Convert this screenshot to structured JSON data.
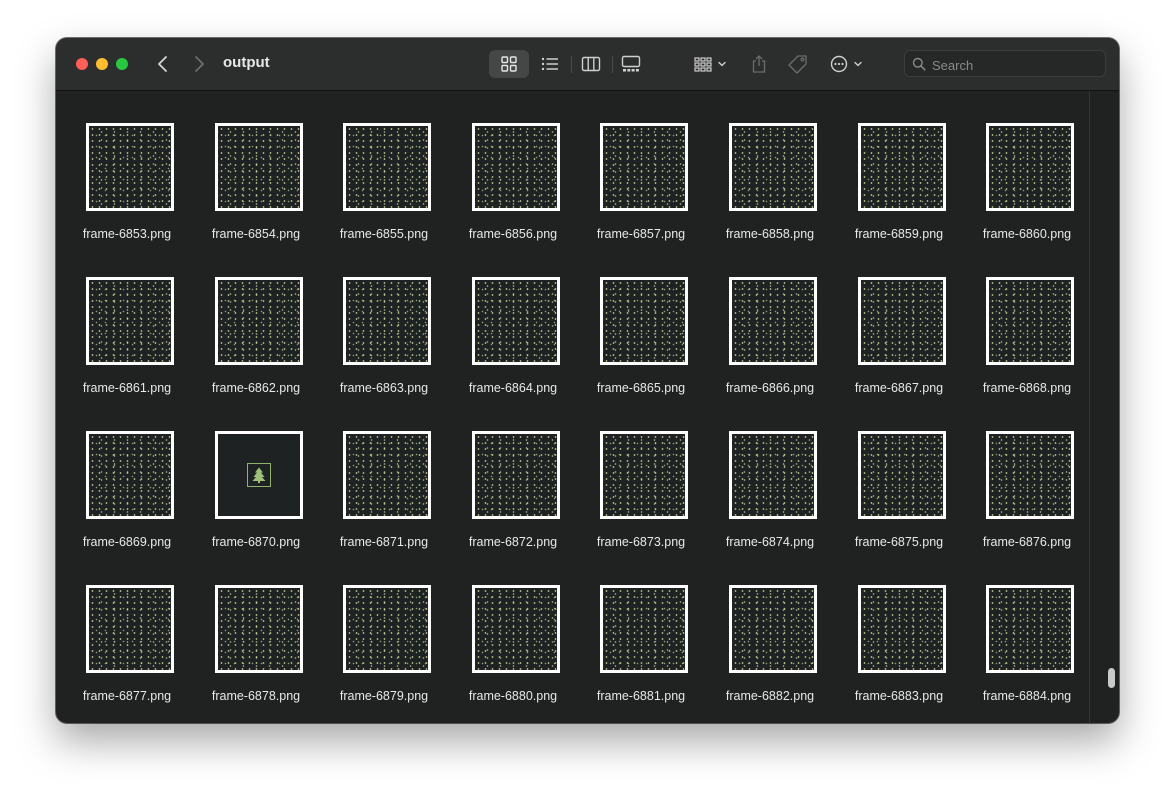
{
  "window": {
    "title": "output",
    "search": {
      "placeholder": "Search",
      "value": ""
    }
  },
  "toolbar": {
    "view_modes": [
      {
        "name": "icon-view",
        "icon": "grid-icon",
        "active": true
      },
      {
        "name": "list-view",
        "icon": "list-icon",
        "active": false
      },
      {
        "name": "column-view",
        "icon": "columns-icon",
        "active": false
      },
      {
        "name": "gallery-view",
        "icon": "gallery-icon",
        "active": false
      }
    ],
    "group_icon": "group-by-icon",
    "share_icon": "share-icon",
    "tag_icon": "tag-icon",
    "action_icon": "more-actions-icon"
  },
  "files": [
    {
      "name": "frame-6853.png",
      "thumb": "noise"
    },
    {
      "name": "frame-6854.png",
      "thumb": "noise"
    },
    {
      "name": "frame-6855.png",
      "thumb": "noise"
    },
    {
      "name": "frame-6856.png",
      "thumb": "noise"
    },
    {
      "name": "frame-6857.png",
      "thumb": "noise"
    },
    {
      "name": "frame-6858.png",
      "thumb": "noise"
    },
    {
      "name": "frame-6859.png",
      "thumb": "noise"
    },
    {
      "name": "frame-6860.png",
      "thumb": "noise"
    },
    {
      "name": "frame-6861.png",
      "thumb": "noise"
    },
    {
      "name": "frame-6862.png",
      "thumb": "noise"
    },
    {
      "name": "frame-6863.png",
      "thumb": "noise"
    },
    {
      "name": "frame-6864.png",
      "thumb": "noise"
    },
    {
      "name": "frame-6865.png",
      "thumb": "noise"
    },
    {
      "name": "frame-6866.png",
      "thumb": "noise"
    },
    {
      "name": "frame-6867.png",
      "thumb": "noise"
    },
    {
      "name": "frame-6868.png",
      "thumb": "noise"
    },
    {
      "name": "frame-6869.png",
      "thumb": "noise"
    },
    {
      "name": "frame-6870.png",
      "thumb": "tree-icon"
    },
    {
      "name": "frame-6871.png",
      "thumb": "noise"
    },
    {
      "name": "frame-6872.png",
      "thumb": "noise"
    },
    {
      "name": "frame-6873.png",
      "thumb": "noise"
    },
    {
      "name": "frame-6874.png",
      "thumb": "noise"
    },
    {
      "name": "frame-6875.png",
      "thumb": "noise"
    },
    {
      "name": "frame-6876.png",
      "thumb": "noise"
    },
    {
      "name": "frame-6877.png",
      "thumb": "noise"
    },
    {
      "name": "frame-6878.png",
      "thumb": "noise"
    },
    {
      "name": "frame-6879.png",
      "thumb": "noise"
    },
    {
      "name": "frame-6880.png",
      "thumb": "noise"
    },
    {
      "name": "frame-6881.png",
      "thumb": "noise"
    },
    {
      "name": "frame-6882.png",
      "thumb": "noise"
    },
    {
      "name": "frame-6883.png",
      "thumb": "noise"
    },
    {
      "name": "frame-6884.png",
      "thumb": "noise"
    }
  ],
  "colors": {
    "window_bg": "#1f2220",
    "titlebar_bg": "#2c2d2d",
    "text": "#e8e8e8",
    "thumb_border": "#ffffff",
    "tree_green": "#8fb36d"
  }
}
